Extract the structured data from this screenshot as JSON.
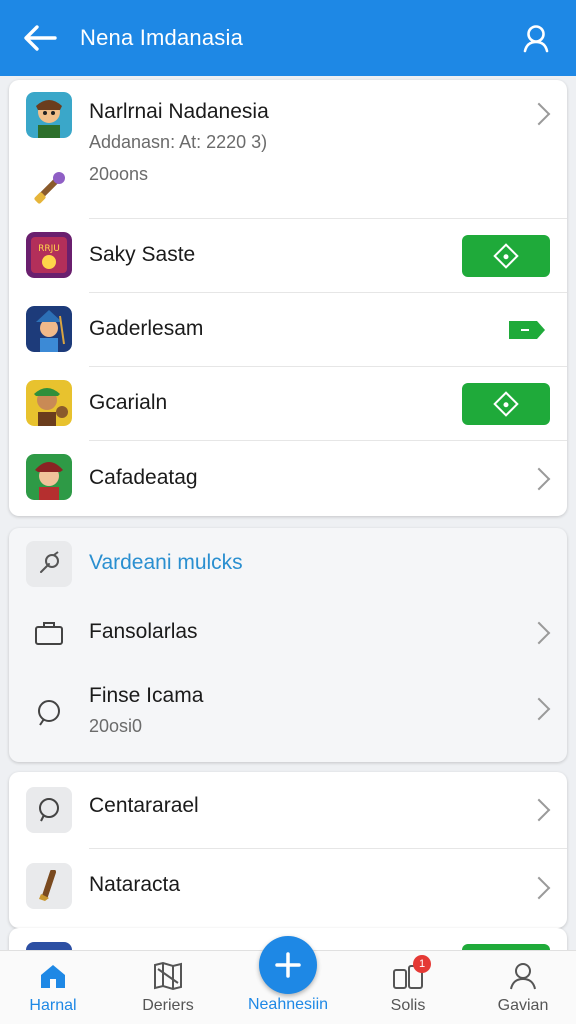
{
  "header": {
    "title": "Nena Imdanasia"
  },
  "games_card": {
    "featured": {
      "title": "Narlrnai Nadanesia",
      "subtitle": "Addanasn: At: 2220 3)",
      "meta": "20oons"
    },
    "items": [
      {
        "label": "Saky Saste",
        "action": "green-button"
      },
      {
        "label": "Gaderlesam",
        "action": "tag"
      },
      {
        "label": "Gcarialn",
        "action": "green-button"
      },
      {
        "label": "Cafadeatag",
        "action": "chevron"
      }
    ]
  },
  "settings_card": {
    "items": [
      {
        "label": "Vardeani mulcks",
        "icon": "wrench-icon"
      },
      {
        "label": "Fansolarlas",
        "icon": "briefcase-icon"
      },
      {
        "label": "Finse Icama",
        "sub": "20osi0",
        "icon": "chat-bubble-icon"
      }
    ]
  },
  "account_card": {
    "items": [
      {
        "label": "Centararael",
        "icon": "chat-bubble-icon"
      },
      {
        "label": "Nataracta",
        "icon": "brush-icon"
      }
    ]
  },
  "bottom_nav": {
    "items": [
      {
        "label": "Harnal",
        "icon": "home-icon"
      },
      {
        "label": "Deriers",
        "icon": "map-icon"
      },
      {
        "label": "Neahnesiin",
        "icon": "plus-icon"
      },
      {
        "label": "Solis",
        "icon": "devices-icon",
        "badge": "1"
      },
      {
        "label": "Gavian",
        "icon": "person-icon"
      }
    ]
  },
  "colors": {
    "primary": "#1e88e5",
    "green": "#1faa3a",
    "badge": "#e53935"
  }
}
